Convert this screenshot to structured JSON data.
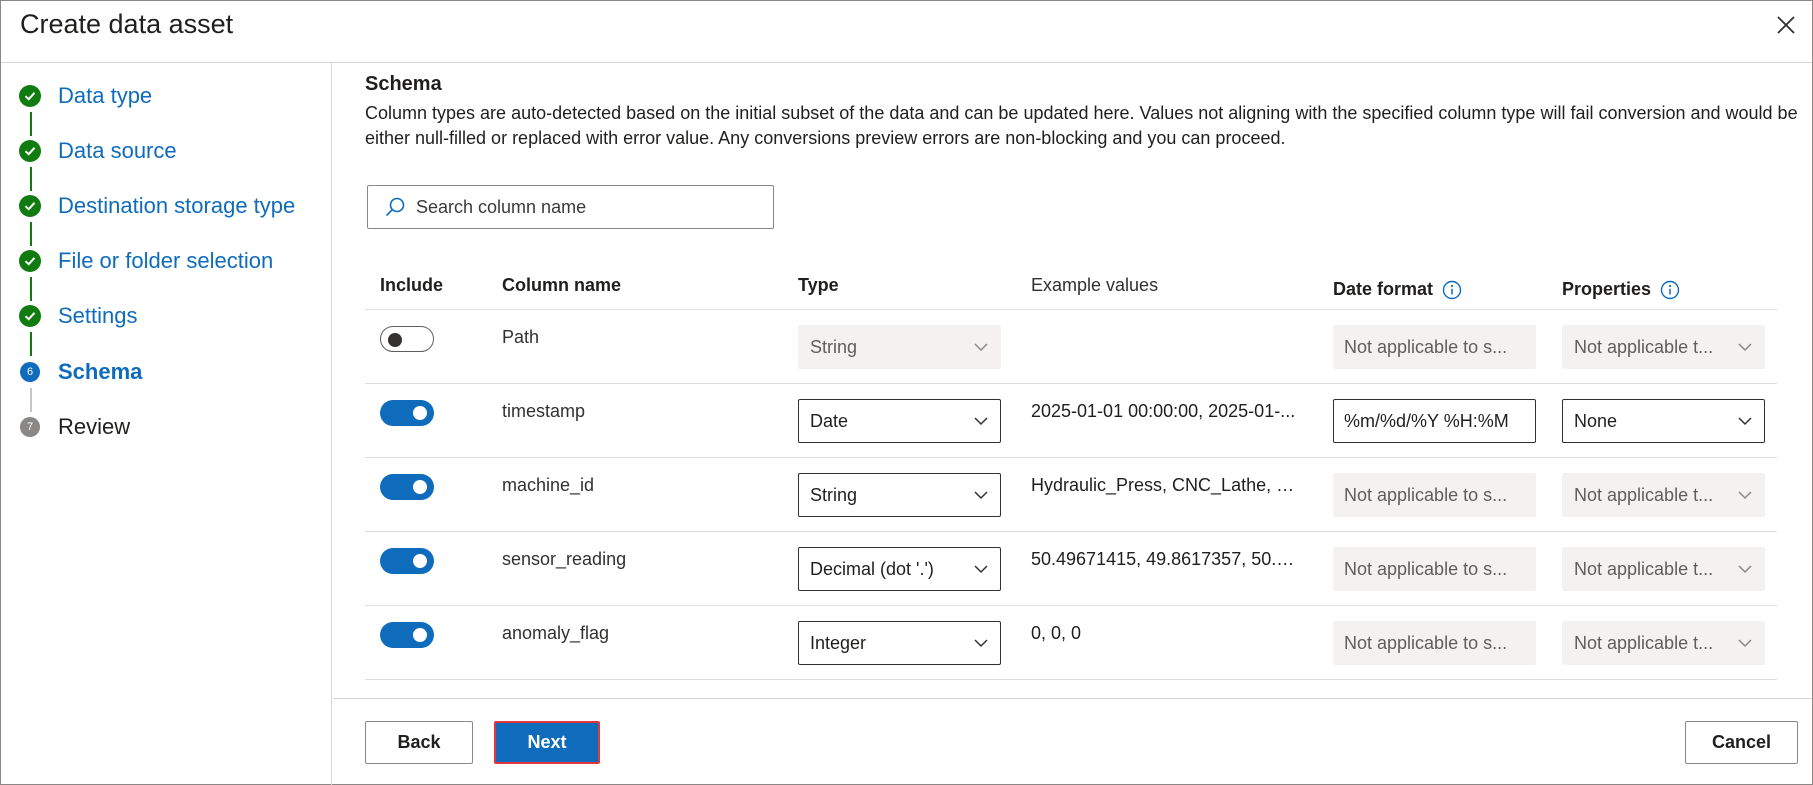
{
  "dialog": {
    "title": "Create data asset"
  },
  "steps": [
    {
      "label": "Data type",
      "state": "done"
    },
    {
      "label": "Data source",
      "state": "done"
    },
    {
      "label": "Destination storage type",
      "state": "done"
    },
    {
      "label": "File or folder selection",
      "state": "done"
    },
    {
      "label": "Settings",
      "state": "done"
    },
    {
      "label": "Schema",
      "state": "current",
      "number": "6"
    },
    {
      "label": "Review",
      "state": "todo",
      "number": "7"
    }
  ],
  "schema": {
    "title": "Schema",
    "description": "Column types are auto-detected based on the initial subset of the data and can be updated here. Values not aligning with the specified column type will fail conversion and would be either null-filled or replaced with error value. Any conversions preview errors are non-blocking and you can proceed.",
    "search_placeholder": "Search column name",
    "headers": {
      "include": "Include",
      "column_name": "Column name",
      "type": "Type",
      "example_values": "Example values",
      "date_format": "Date format",
      "properties": "Properties"
    },
    "rows": [
      {
        "include": false,
        "name": "Path",
        "type": "String",
        "example": "",
        "date_format": "Not applicable to s...",
        "properties": "Not applicable t..."
      },
      {
        "include": true,
        "name": "timestamp",
        "type": "Date",
        "example": "2025-01-01 00:00:00, 2025-01-...",
        "date_format": "%m/%d/%Y %H:%M",
        "properties": "None"
      },
      {
        "include": true,
        "name": "machine_id",
        "type": "String",
        "example": "Hydraulic_Press, CNC_Lathe, C...",
        "date_format": "Not applicable to s...",
        "properties": "Not applicable t..."
      },
      {
        "include": true,
        "name": "sensor_reading",
        "type": "Decimal (dot '.')",
        "example": "50.49671415, 49.8617357, 50.6...",
        "date_format": "Not applicable to s...",
        "properties": "Not applicable t..."
      },
      {
        "include": true,
        "name": "anomaly_flag",
        "type": "Integer",
        "example": "0, 0, 0",
        "date_format": "Not applicable to s...",
        "properties": "Not applicable t..."
      }
    ]
  },
  "footer": {
    "back_label": "Back",
    "next_label": "Next",
    "cancel_label": "Cancel"
  },
  "colors": {
    "accent": "#0f6cbd",
    "done": "#107c10",
    "highlight_border": "#e3353b"
  }
}
